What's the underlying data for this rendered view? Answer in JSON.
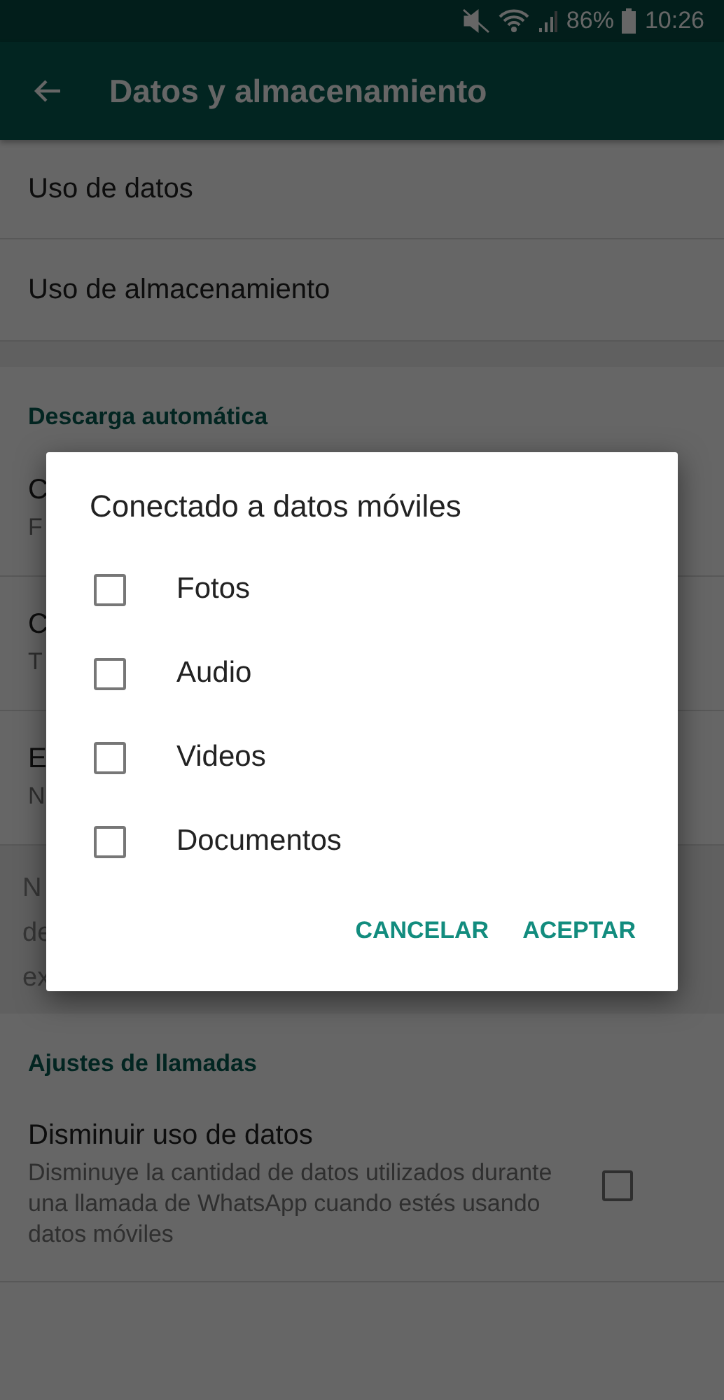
{
  "status_bar": {
    "battery": "86%",
    "time": "10:26"
  },
  "app_bar": {
    "title": "Datos y almacenamiento"
  },
  "top_items": [
    {
      "title": "Uso de datos"
    },
    {
      "title": "Uso de almacenamiento"
    }
  ],
  "auto_download": {
    "header": "Descarga automática",
    "items": [
      {
        "title": "C",
        "subtitle": "F"
      },
      {
        "title": "C",
        "subtitle": "T"
      },
      {
        "title": "E",
        "subtitle": "N"
      }
    ],
    "note_lines": [
      "N",
      "de",
      "ex"
    ]
  },
  "call_settings": {
    "header": "Ajustes de llamadas",
    "items": [
      {
        "title": "Disminuir uso de datos",
        "subtitle": "Disminuye la cantidad de datos utilizados durante una llamada de WhatsApp cuando estés usando datos móviles",
        "checked": false
      }
    ]
  },
  "dialog": {
    "title": "Conectado a datos móviles",
    "options": [
      {
        "label": "Fotos",
        "checked": false
      },
      {
        "label": "Audio",
        "checked": false
      },
      {
        "label": "Videos",
        "checked": false
      },
      {
        "label": "Documentos",
        "checked": false
      }
    ],
    "buttons": [
      "CANCELAR",
      "ACEPTAR"
    ]
  }
}
